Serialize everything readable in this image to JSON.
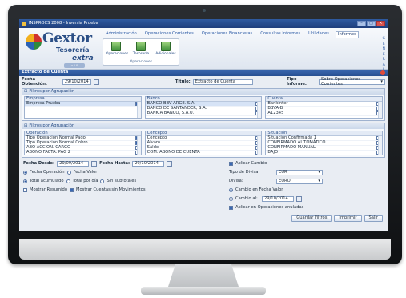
{
  "window": {
    "title": "INSPROCS 2008 - Inversia Prueba"
  },
  "ribbon": {
    "logo": {
      "brand": "Gextor",
      "sub": "Tesorería",
      "extra": "extra",
      "version": "v.4.0"
    },
    "tabs": [
      "Administración",
      "Operaciones Corrientes",
      "Operaciones Financieras",
      "Consultas Informes",
      "Utilidades",
      "Informes"
    ],
    "active_tab": "Informes",
    "group": {
      "buttons": [
        "Operaciones",
        "Tesorería",
        "Adicionales"
      ],
      "label": "Operaciones"
    },
    "side": [
      "G",
      "E",
      "N",
      "E",
      "R",
      "A",
      "L"
    ]
  },
  "section": {
    "title": "Extracto de Cuenta"
  },
  "form": {
    "fecha_label": "Fecha Obtención:",
    "fecha_value": "29/10/2014",
    "titulo_label": "Título:",
    "titulo_value": "Extracto de Cuenta",
    "tipo_label": "Tipo Informe:",
    "tipo_value": "Sobre Operaciones Corrientes"
  },
  "panel1": {
    "header": "Filtros por Agrupación",
    "empresa_head": "Empresa",
    "empresa_items": [
      "Empresa Prueba"
    ],
    "banco_head": "Banco",
    "banco_items": [
      "BANCO BBV ARGE. S.A.",
      "BANCO DE SANTANDER, S.A.",
      "BANKIA BANCO, S.A.U."
    ],
    "cuenta_head": "Cuenta",
    "cuenta_items": [
      "Bankinter",
      "BBVA-B",
      "A12345"
    ]
  },
  "panel2": {
    "header": "Filtros por Agrupación",
    "op_head": "Operación",
    "op_items": [
      "Tipo Operación Normal Pago",
      "Tipo Operación Normal Cobro",
      "ABO ACCION. CARGO",
      "ABONO FACTA. PAG 2"
    ],
    "concepto_head": "Concepto",
    "concepto_items": [
      "Concepto",
      "Alvaro",
      "Saldo",
      "COM. ABONO DE CUENTA"
    ],
    "situacion_head": "Situación",
    "situacion_items": [
      "Situación Confirmada 1",
      "CONFIRMADO AUTOMÁTICO",
      "CONFIRMADO MANUAL",
      "BAJO"
    ]
  },
  "lower": {
    "fecha_desde_label": "Fecha Desde:",
    "fecha_desde": "29/09/2014",
    "fecha_hasta_label": "Fecha Hasta:",
    "fecha_hasta": "29/10/2014",
    "radio_fecha_op": "Fecha Operación",
    "radio_fecha_valor": "Fecha Valor",
    "radio_total": "Total acumulado",
    "radio_solo_por": "Total por día",
    "radio_sin_saldos": "Sin subtotales",
    "chk_resumido": "Mostrar Resumido",
    "chk_cuentas": "Mostrar Cuentas sin Movimientos",
    "chk_cambio": "Aplicar Cambio",
    "tipo_divisa_label": "Tipo de Divisa:",
    "tipo_divisa": "EUR",
    "divisa_label": "Divisa:",
    "divisa": "EURO",
    "chk_cambio_fecha": "Cambio en Fecha Valor",
    "cambio_al_label": "Cambio al:",
    "cambio_al": "29/10/2014",
    "chk_aplicar": "Aplicar en Operaciones anuladas"
  },
  "buttons": {
    "guardar": "Guardar Filtros",
    "imprimir": "Imprimir",
    "salir": "Salir"
  }
}
